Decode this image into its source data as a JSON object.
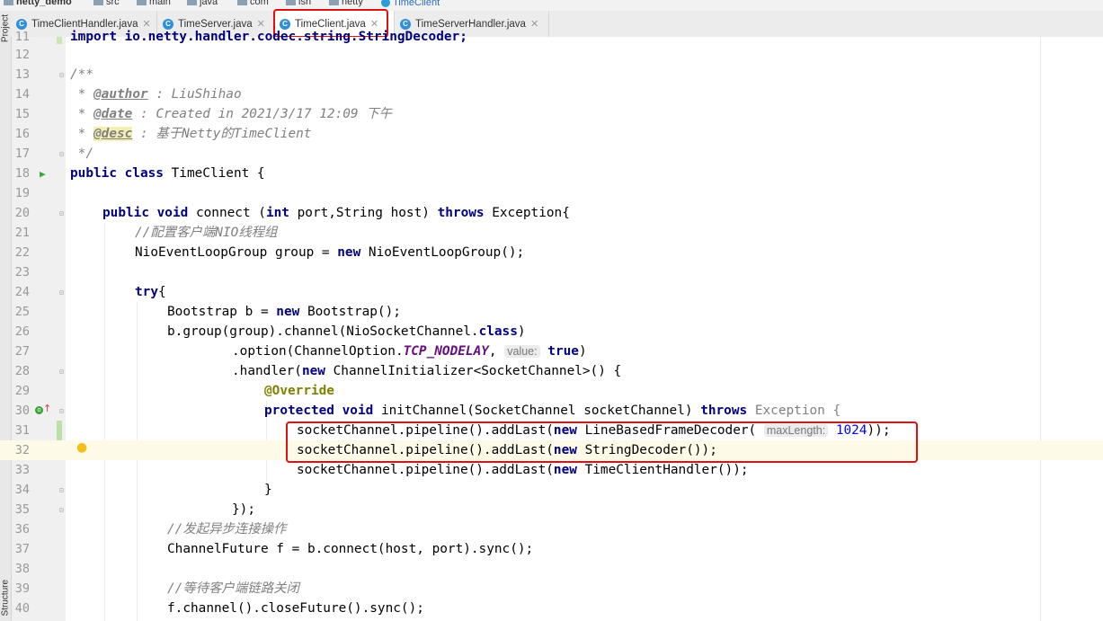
{
  "breadcrumb": {
    "items": [
      "netty_demo",
      "src",
      "main",
      "java",
      "com",
      "lsh",
      "netty",
      "TimeClient"
    ]
  },
  "tabs": [
    {
      "label": "TimeClientHandler.java",
      "active": false
    },
    {
      "label": "TimeServer.java",
      "active": false
    },
    {
      "label": "TimeClient.java",
      "active": true
    },
    {
      "label": "TimeServerHandler.java",
      "active": false
    }
  ],
  "sidebar": {
    "top_label": "Project",
    "bottom_label": "Structure"
  },
  "editor": {
    "line_numbers": [
      "11",
      "12",
      "13",
      "14",
      "15",
      "16",
      "17",
      "18",
      "19",
      "20",
      "21",
      "22",
      "23",
      "24",
      "25",
      "26",
      "27",
      "28",
      "29",
      "30",
      "31",
      "32",
      "33",
      "34",
      "35",
      "36",
      "37",
      "38",
      "39",
      "40"
    ],
    "lines": {
      "l11": "import io.netty.handler.codec.string.StringDecoder;",
      "l13": "/**",
      "l14_star": " * ",
      "l14_tag": "@author",
      "l14_text": " : LiuShihao",
      "l15_tag": "@date",
      "l15_text": " : Created in 2021/3/17 12:09 下午",
      "l16_tag": "@desc",
      "l16_text": " : 基于Netty的TimeClient",
      "l17": " */",
      "l18_kw": "public class",
      "l18_rest": " TimeClient {",
      "l20_kw1": "public void",
      "l20_mid": " connect (",
      "l20_kw2": "int",
      "l20_mid2": " port,String host) ",
      "l20_kw3": "throws",
      "l20_rest": " Exception{",
      "l21": "//配置客户端NIO线程组",
      "l22_a": "NioEventLoopGroup group = ",
      "l22_kw": "new",
      "l22_b": " NioEventLoopGroup();",
      "l24_kw": "try",
      "l24_rest": "{",
      "l25_a": "Bootstrap b = ",
      "l25_kw": "new",
      "l25_b": " Bootstrap();",
      "l26_a": "b.group(group).channel(NioSocketChannel.",
      "l26_kw": "class",
      "l26_b": ")",
      "l27_a": ".option(ChannelOption.",
      "l27_const": "TCP_NODELAY",
      "l27_sep": ", ",
      "l27_hint": "value:",
      "l27_kw": "true",
      "l27_b": ")",
      "l28_a": ".handler(",
      "l28_kw": "new",
      "l28_b": " ChannelInitializer<SocketChannel>() {",
      "l29": "@Override",
      "l30_kw": "protected void",
      "l30_a": " initChannel(SocketChannel socketChannel) ",
      "l30_kw2": "throws",
      "l30_b": " Exception {",
      "l31_a": "socketChannel.pipeline().addLast(",
      "l31_kw": "new",
      "l31_b": " LineBasedFrameDecoder( ",
      "l31_hint": "maxLength:",
      "l31_num": "1024",
      "l31_c": "));",
      "l32_a": "socketChannel.pipeline().addLast(",
      "l32_kw": "new",
      "l32_b": " StringDecoder());",
      "l33_a": "socketChannel.pipeline().addLast(",
      "l33_kw": "new",
      "l33_b": " TimeClientHandler());",
      "l34": "}",
      "l35": "});",
      "l36": "//发起异步连接操作",
      "l37": "ChannelFuture f = b.connect(host, port).sync();",
      "l39": "//等待客户端链路关闭",
      "l40": "f.channel().closeFuture().sync();"
    }
  },
  "colors": {
    "highlight_box": "#e01010",
    "keyword": "#000080",
    "comment": "#808080",
    "annotation": "#808000"
  }
}
